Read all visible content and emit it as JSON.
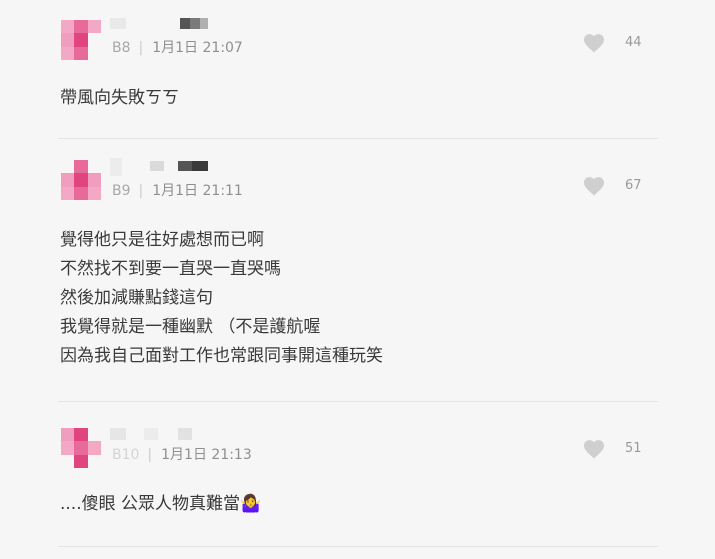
{
  "comments": [
    {
      "floor": "B8",
      "date": "1月1日 21:07",
      "likes": "44",
      "lines": [
        "帶風向失敗ㄎㄎ"
      ]
    },
    {
      "floor": "B9",
      "date": "1月1日 21:11",
      "likes": "67",
      "lines": [
        "覺得他只是往好處想而已啊",
        "不然找不到要一直哭一直哭嗎",
        "然後加減賺點錢這句",
        "我覺得就是一種幽默 （不是護航喔",
        "因為我自己面對工作也常跟同事開這種玩笑"
      ]
    },
    {
      "floor": "B10",
      "date": "1月1日 21:13",
      "likes": "51",
      "lines": [
        "....傻眼 公眾人物真難當🤷‍♀️"
      ]
    }
  ],
  "icons": {
    "like": "heart-icon"
  },
  "colors": {
    "background": "#f6f6f6",
    "avatar_pink_dark": "#e0457f",
    "avatar_pink_light": "#f19dbd",
    "heart": "#cfcfcf"
  }
}
